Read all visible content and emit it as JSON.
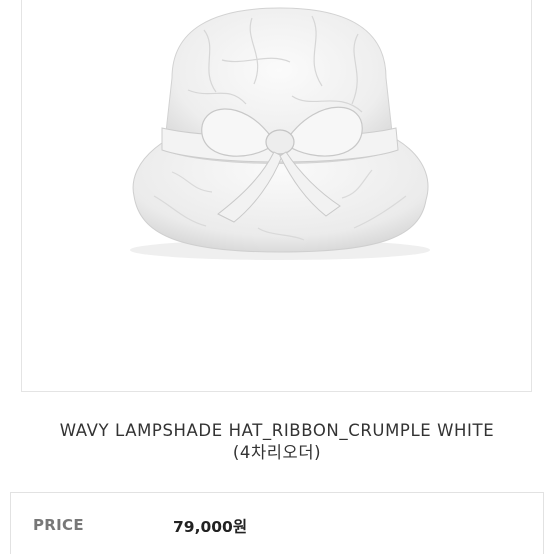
{
  "product": {
    "image_alt": "white crumpled bucket hat with ribbon",
    "title_line1": "WAVY LAMPSHADE HAT_RIBBON_CRUMPLE WHITE",
    "title_line2": "(4차리오더)"
  },
  "price": {
    "label": "PRICE",
    "value": "79,000원"
  },
  "colors": {
    "frame_border": "#e4e4e4",
    "title_text": "#333333",
    "price_label": "#777777",
    "price_value": "#222222"
  }
}
